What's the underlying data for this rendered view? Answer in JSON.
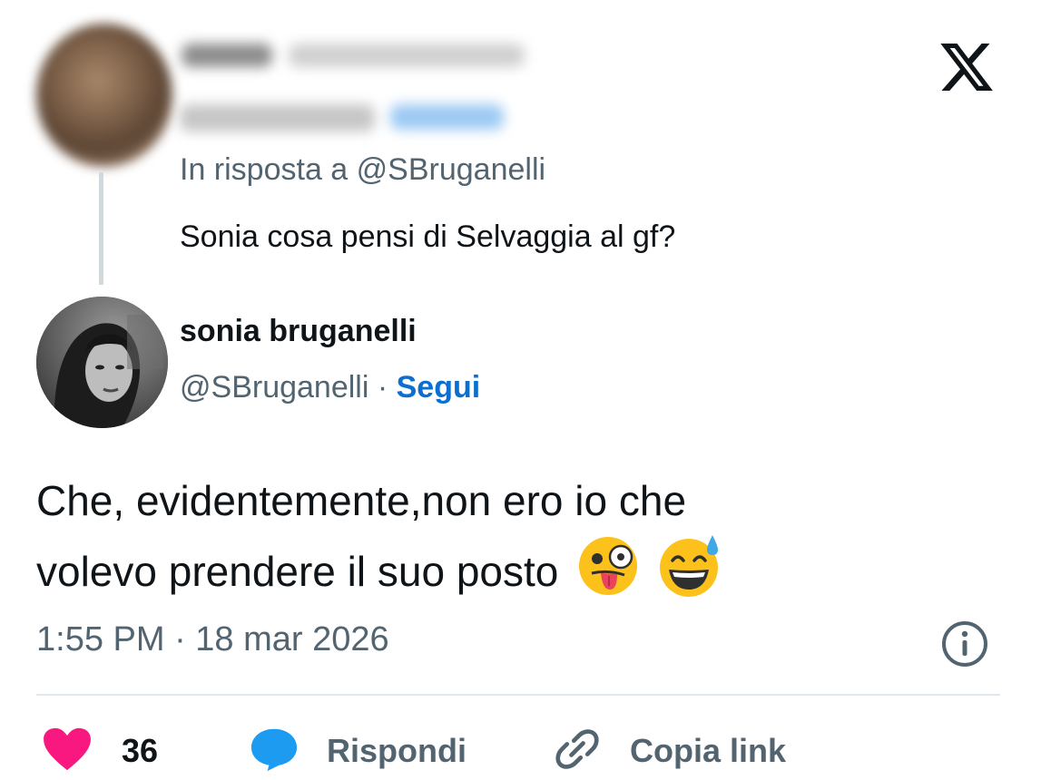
{
  "parent_tweet": {
    "reply_to_text": "In risposta a @SBruganelli",
    "text": "Sonia cosa pensi di Selvaggia al gf?"
  },
  "tweet": {
    "author": {
      "display_name": "sonia bruganelli",
      "handle": "@SBruganelli",
      "separator": " · ",
      "follow_label": "Segui"
    },
    "text_lines": [
      "Che, evidentemente,non ero io che",
      "volevo prendere il suo posto"
    ],
    "emojis": [
      "zany-face-emoji",
      "grinning-sweat-emoji"
    ],
    "timestamp": "1:55 PM · 18 mar 2026"
  },
  "actions": {
    "like_count": "36",
    "reply_label": "Rispondi",
    "copy_link_label": "Copia link"
  },
  "icons": {
    "close": "x-logo-close-icon",
    "info": "info-icon",
    "like": "heart-icon",
    "reply": "speech-bubble-icon",
    "copy_link": "link-icon"
  },
  "colors": {
    "like": "#f91880",
    "reply": "#1d9bf0",
    "follow": "#0a6fd1",
    "secondary_text": "#536471"
  }
}
